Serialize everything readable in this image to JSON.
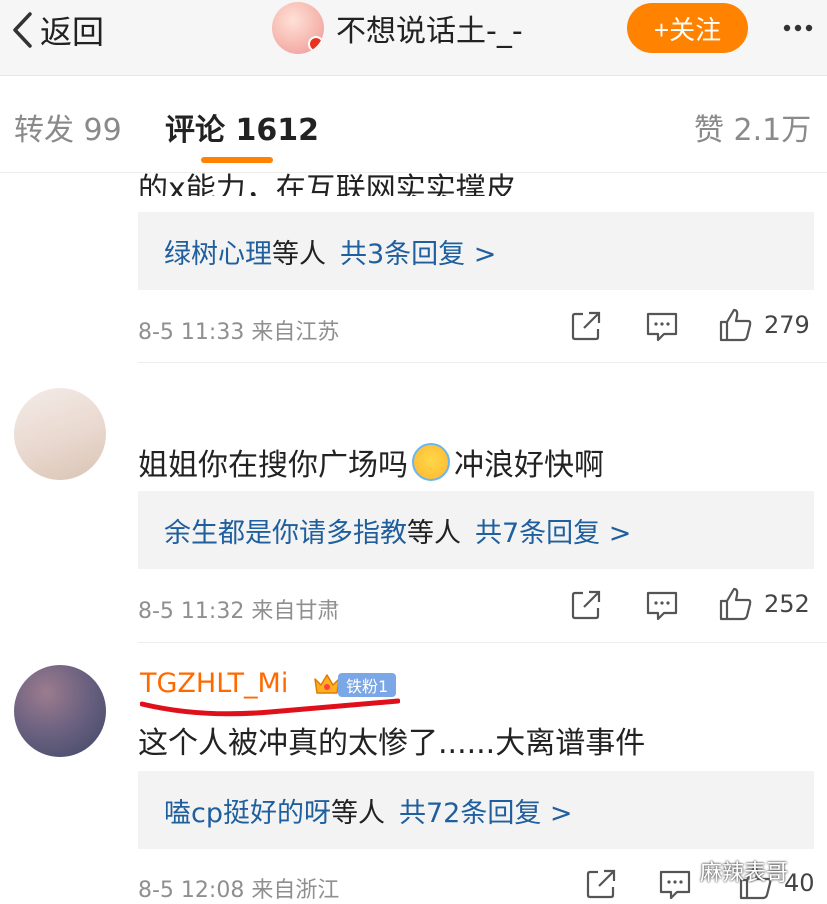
{
  "header": {
    "back_label": "返回",
    "username": "不想说话土-_-",
    "follow_label": "+关注"
  },
  "tabs": [
    {
      "label": "转发 99"
    },
    {
      "label": "评论 1612"
    },
    {
      "label": "赞 2.1万"
    }
  ],
  "comments": [
    {
      "text_partial": "的x能力，在互联网实实撑皮",
      "reply_user": "绿树心理",
      "reply_mid": "等人",
      "reply_count": "共3条回复 >",
      "time": "8-5 11:33",
      "location": "来自江苏",
      "likes": "279"
    },
    {
      "text": "姐姐你在搜你广场吗",
      "text_after": "冲浪好快啊",
      "reply_user": "余生都是你请多指教",
      "reply_mid": "等人",
      "reply_count": "共7条回复 >",
      "time": "8-5 11:32",
      "location": "来自甘肃",
      "likes": "252"
    },
    {
      "username": "TGZHLT_Mi",
      "fan_badge": "铁粉1",
      "text": "这个人被冲真的太惨了......大离谱事件",
      "reply_user": "嗑cp挺好的呀",
      "reply_mid": "等人",
      "reply_count": "共72条回复 >",
      "time": "8-5 12:08",
      "location": "来自浙江",
      "likes": "40"
    }
  ],
  "watermark": "麻辣表哥",
  "colors": {
    "accent": "#ff8200",
    "link": "#1f5f9e",
    "username": "#ff6a00"
  }
}
